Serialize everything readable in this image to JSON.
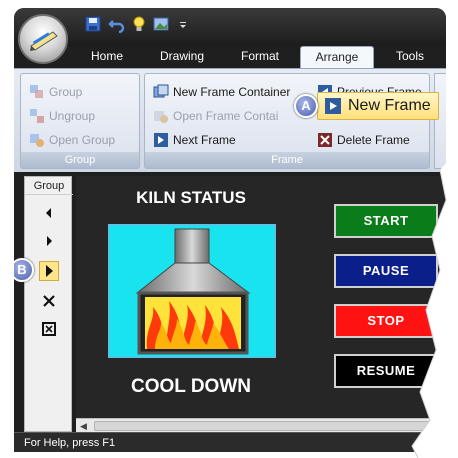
{
  "ribbon": {
    "tabs": [
      "Home",
      "Drawing",
      "Format",
      "Arrange",
      "Tools"
    ],
    "active_tab": "Arrange",
    "group_group": {
      "label": "Group",
      "items": [
        "Group",
        "Ungroup",
        "Open Group"
      ]
    },
    "frame_group": {
      "label": "Frame",
      "items": [
        "New Frame Container",
        "Open Frame Contai",
        "Next Frame",
        "Previous Frame",
        "Delete Frame"
      ],
      "highlighted_item": "New Frame"
    }
  },
  "callouts": {
    "a": "A",
    "b": "B"
  },
  "group_toolbar": {
    "title": "Group",
    "buttons": [
      "previous-icon",
      "next-icon",
      "next-frame-icon",
      "delete-icon",
      "frame-box-icon"
    ],
    "selected": "next-frame-icon"
  },
  "hmi": {
    "title": "KILN STATUS",
    "status": "COOL DOWN",
    "buttons": [
      {
        "label": "START",
        "color": "#0a7d1a"
      },
      {
        "label": "PAUSE",
        "color": "#0a1f8a"
      },
      {
        "label": "STOP",
        "color": "#ff1212"
      },
      {
        "label": "RESUME",
        "color": "#000000"
      }
    ],
    "kiln_bg": "#19e3ee"
  },
  "status_bar": {
    "text": "For Help, press F1"
  }
}
